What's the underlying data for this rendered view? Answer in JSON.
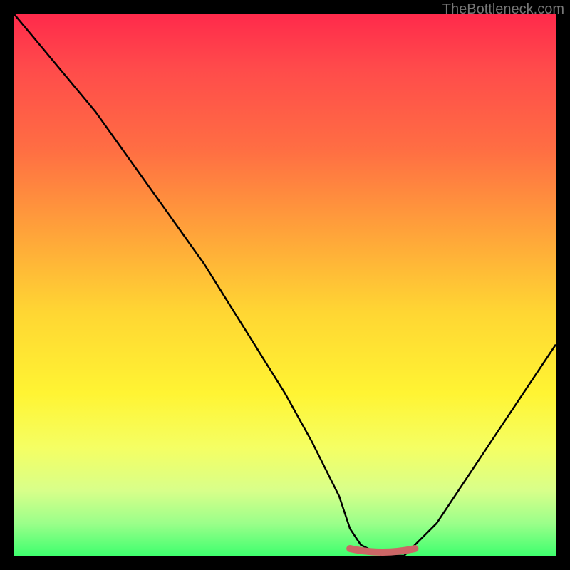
{
  "watermark": "TheBottleneck.com",
  "chart_data": {
    "type": "line",
    "title": "",
    "xlabel": "",
    "ylabel": "",
    "xlim": [
      0,
      100
    ],
    "ylim": [
      0,
      100
    ],
    "series": [
      {
        "name": "curve",
        "x": [
          0,
          5,
          10,
          15,
          20,
          25,
          30,
          35,
          40,
          45,
          50,
          55,
          60,
          62,
          64,
          68,
          72,
          74,
          78,
          82,
          86,
          90,
          94,
          98,
          100
        ],
        "values": [
          100,
          94,
          88,
          82,
          75,
          68,
          61,
          54,
          46,
          38,
          30,
          21,
          11,
          5,
          2,
          0,
          0,
          2,
          6,
          12,
          18,
          24,
          30,
          36,
          39
        ]
      }
    ],
    "highlight": {
      "name": "flat-minimum",
      "x_start": 62,
      "x_end": 74,
      "y": 0,
      "color": "#cc6666"
    },
    "background_gradient": {
      "top": "#ff2a4b",
      "mid_upper": "#ffa23a",
      "mid": "#fff433",
      "bottom": "#3fff6e"
    }
  }
}
